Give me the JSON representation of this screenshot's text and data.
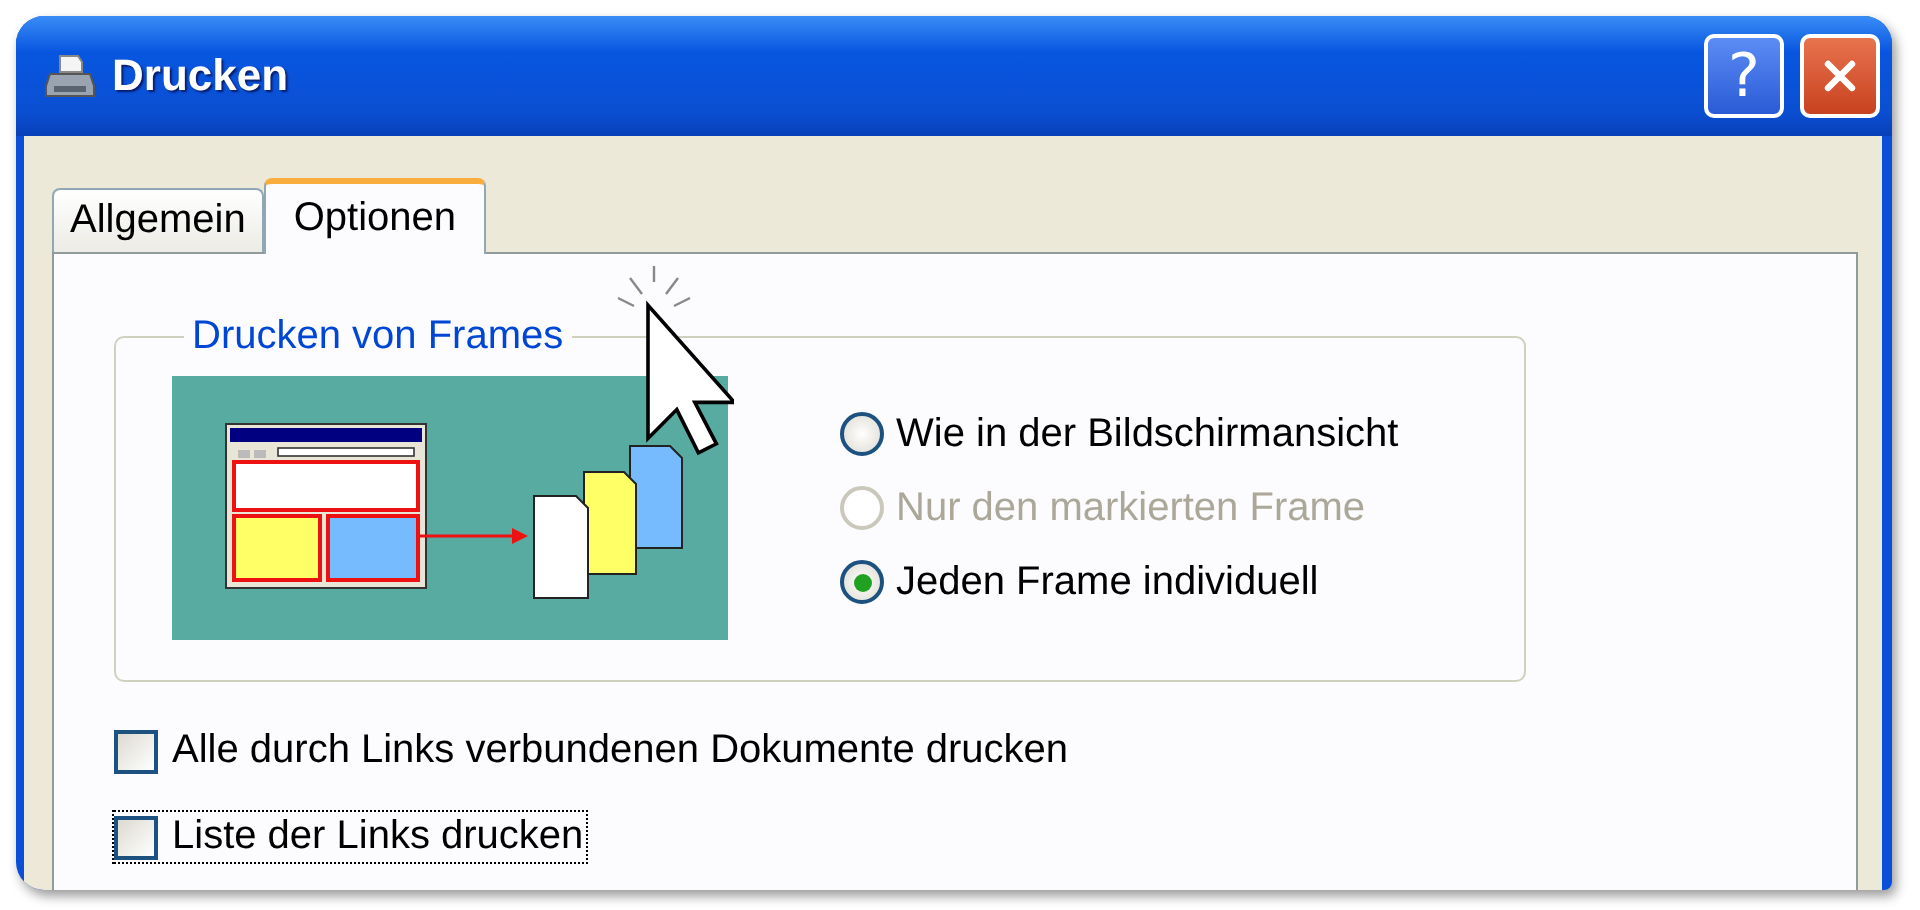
{
  "window": {
    "title": "Drucken",
    "help_button": "?"
  },
  "tabs": [
    {
      "label": "Allgemein",
      "selected": false
    },
    {
      "label": "Optionen",
      "selected": true
    }
  ],
  "frames_group": {
    "legend": "Drucken von Frames",
    "options": [
      {
        "label": "Wie in der Bildschirmansicht",
        "selected": false,
        "disabled": false
      },
      {
        "label": "Nur den markierten Frame",
        "selected": false,
        "disabled": true
      },
      {
        "label": "Jeden Frame individuell",
        "selected": true,
        "disabled": false
      }
    ]
  },
  "checkboxes": [
    {
      "label": "Alle durch Links verbundenen Dokumente drucken",
      "checked": false,
      "focused": false
    },
    {
      "label": "Liste der Links drucken",
      "checked": false,
      "focused": true
    }
  ]
}
